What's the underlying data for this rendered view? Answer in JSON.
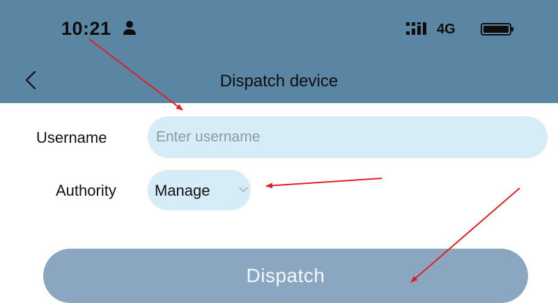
{
  "status_bar": {
    "time": "10:21",
    "network": "4G",
    "icons": [
      "person-icon",
      "signal-icon",
      "battery-icon"
    ]
  },
  "header": {
    "back_icon": "chevron-left-icon",
    "title": "Dispatch device"
  },
  "form": {
    "username": {
      "label": "Username",
      "placeholder": "Enter username",
      "value": ""
    },
    "authority": {
      "label": "Authority",
      "selected": "Manage",
      "icon": "chevron-down-icon"
    }
  },
  "dispatch_button": {
    "label": "Dispatch"
  },
  "colors": {
    "header_bg": "#5a86a3",
    "field_bg": "#d6ecf6",
    "button_bg": "#8ba6c0",
    "annotation_arrow": "#e02020"
  }
}
